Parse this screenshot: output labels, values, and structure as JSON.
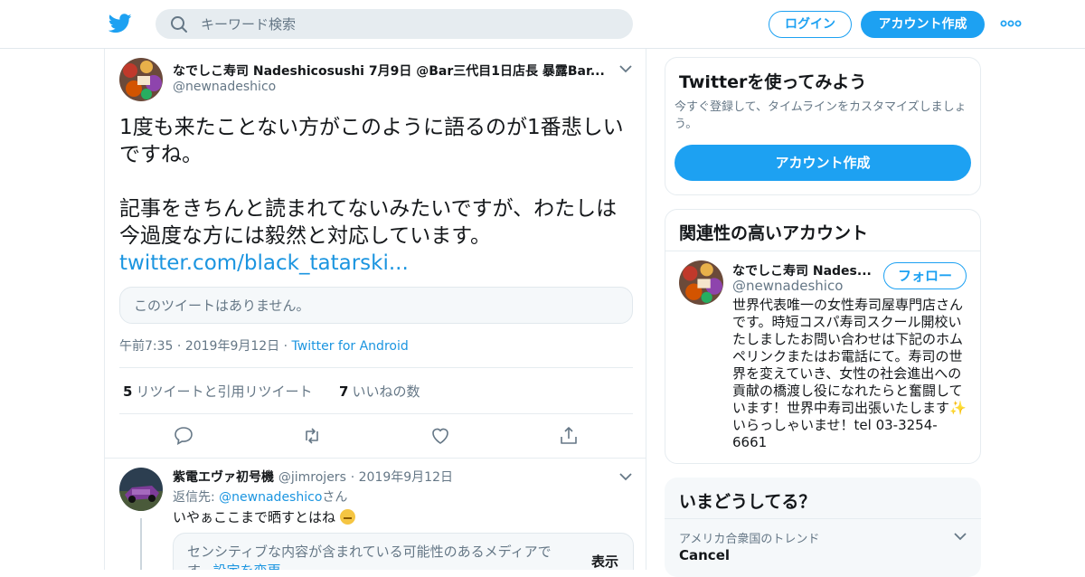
{
  "topbar": {
    "search_placeholder": "キーワード検索",
    "login_label": "ログイン",
    "signup_label": "アカウント作成"
  },
  "tweet": {
    "display_name": "なでしこ寿司 Nadeshicosushi 7月9日 @Bar三代目1日店長 暴露Bar...",
    "handle": "@newnadeshico",
    "text_line1": "1度も来たことない方がこのように語るのが1番悲しいですね。",
    "text_line2": "記事をきちんと読まれてないみたいですが、わたしは今過度な方には毅然と対応しています。",
    "link": "twitter.com/black_tatarski...",
    "quote_unavailable": "このツイートはありません。",
    "time": "午前7:35",
    "date": "2019年9月12日",
    "source": "Twitter for Android",
    "retweet_count": "5",
    "retweet_label": "リツイートと引用リツイート",
    "like_count": "7",
    "like_label": "いいねの数"
  },
  "reply": {
    "display_name": "紫電エヴァ初号機",
    "handle": "@jimrojers",
    "date": "2019年9月12日",
    "replying_prefix": "返信先: ",
    "replying_to": "@newnadeshico",
    "replying_suffix": "さん",
    "text": "いやぁここまで晒すとはね",
    "sensitive_text": "センシティブな内容が含まれている可能性のあるメディアです。",
    "sensitive_link": "設定を変更",
    "show_label": "表示"
  },
  "sidebar": {
    "try_title": "Twitterを使ってみよう",
    "try_desc": "今すぐ登録して、タイムラインをカスタマイズしましょう。",
    "try_button": "アカウント作成",
    "related_title": "関連性の高いアカウント",
    "account_name": "なでしこ寿司 Nades...",
    "account_handle": "@newnadeshico",
    "follow_label": "フォロー",
    "account_bio": "世界代表唯一の女性寿司屋専門店さんです。時短コスパ寿司スクール開校いたしましたお問い合わせは下記のホムペリンクまたはお電話にて。寿司の世界を変えていき、女性の社会進出への貢献の橋渡し役になれたらと奮闘しています！世界中寿司出張いたします✨いらっしゃいませ！tel 03-3254-6661",
    "trends_title": "いまどうしてる？",
    "trend_context": "アメリカ合衆国のトレンド",
    "trend_name": "Cancel"
  },
  "colors": {
    "accent": "#1da1f2",
    "link": "#1b95e0",
    "secondary_text": "#657786"
  }
}
